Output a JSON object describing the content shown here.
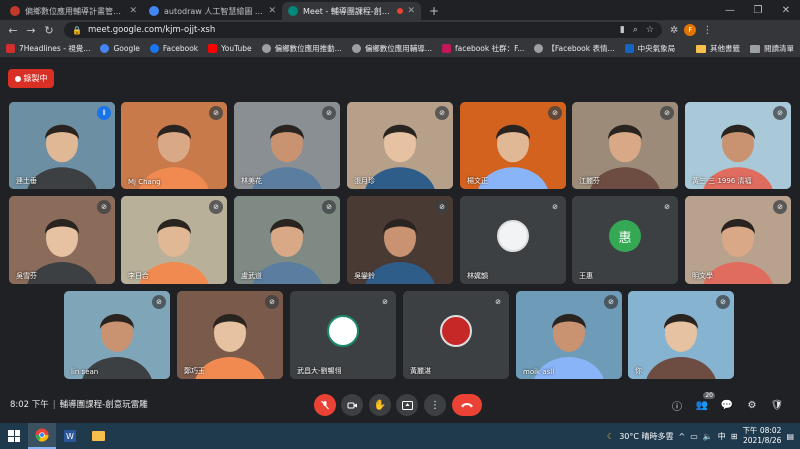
{
  "browser": {
    "tabs": [
      {
        "title": "偏鄉數位應用輔導計畫管理後台",
        "color": "#c0392b"
      },
      {
        "title": "autodraw 人工智慧繪圖 - Google",
        "color": "#4285f4"
      },
      {
        "title": "Meet - 輔導團課程-創意玩雷雕",
        "color": "#00897b",
        "active": true
      }
    ],
    "new_tab": "+",
    "window_controls": [
      "—",
      "❐",
      "✕"
    ],
    "url": "meet.google.com/kjm-ojjt-xsh",
    "profile_initial": "F"
  },
  "bookmarks": [
    {
      "label": "7Headlines - 視覺...",
      "color": "#d32f2f",
      "glyph": "7"
    },
    {
      "label": "Google",
      "color": "#4285f4",
      "glyph": "G"
    },
    {
      "label": "Facebook",
      "color": "#1877f2",
      "glyph": "f"
    },
    {
      "label": "YouTube",
      "color": "#ff0000",
      "glyph": "▶"
    },
    {
      "label": "偏鄉數位應用推動...",
      "color": "#9aa0a6",
      "glyph": "◎"
    },
    {
      "label": "偏鄉數位應用輔導...",
      "color": "#9aa0a6",
      "glyph": "◎"
    },
    {
      "label": "facebook 社群：F...",
      "color": "#c2185b",
      "glyph": "f"
    },
    {
      "label": "【Facebook 表情...",
      "color": "#9aa0a6",
      "glyph": "◎"
    },
    {
      "label": "中央氣象局",
      "color": "#1565c0",
      "glyph": "☁"
    }
  ],
  "bookmarks_right": [
    "其他書籤",
    "閱讀清單"
  ],
  "meet": {
    "recording_label": "錄製中",
    "meeting_time": "8:02 下午",
    "meeting_title": "輔導團課程-創意玩雷雕",
    "participant_count": "20",
    "participants": [
      {
        "name": "連土垂",
        "speaking": true,
        "initial": "",
        "bg": "#6d8fa3"
      },
      {
        "name": "Mj Chang",
        "speaking": false,
        "initial": "",
        "bg": "#c87a4a"
      },
      {
        "name": "林美花",
        "speaking": false,
        "initial": "",
        "bg": "#8a8f94"
      },
      {
        "name": "張月珍",
        "speaking": false,
        "initial": "",
        "bg": "#b7a08a"
      },
      {
        "name": "楊文正",
        "speaking": false,
        "initial": "",
        "bg": "#d4621f"
      },
      {
        "name": "江麗芬",
        "speaking": false,
        "initial": "",
        "bg": "#9c8b78"
      },
      {
        "name": "黃三 三 1996 清福",
        "speaking": false,
        "initial": "",
        "bg": "#a9c9d8"
      },
      {
        "name": "吳雪芬",
        "speaking": false,
        "initial": "",
        "bg": "#8b6b5a"
      },
      {
        "name": "李日合",
        "speaking": false,
        "initial": "",
        "bg": "#b9b09a"
      },
      {
        "name": "盧武道",
        "speaking": false,
        "initial": "",
        "bg": "#7f8a84"
      },
      {
        "name": "吳鑾鈴",
        "speaking": false,
        "initial": "",
        "bg": "#4a3a34"
      },
      {
        "name": "林娓韻",
        "speaking": false,
        "initial": "",
        "bg": "#3c4043"
      },
      {
        "name": "王惠",
        "speaking": false,
        "initial": "惠",
        "bg": "#3c4043"
      },
      {
        "name": "明文學",
        "speaking": false,
        "initial": "",
        "bg": "#b8a28e"
      },
      {
        "name": "lin sean",
        "speaking": false,
        "initial": "",
        "bg": "#7fa6b8"
      },
      {
        "name": "鄭巧玉",
        "speaking": false,
        "initial": "",
        "bg": "#7a5a4a"
      },
      {
        "name": "武昌大-劉暢翎",
        "speaking": false,
        "initial": "",
        "bg": "#3c4043"
      },
      {
        "name": "黃麗湛",
        "speaking": false,
        "initial": "",
        "bg": "#3c4043"
      },
      {
        "name": "moik asll",
        "speaking": false,
        "initial": "",
        "bg": "#6d9bb8"
      },
      {
        "name": "你",
        "speaking": false,
        "initial": "",
        "bg": "#86b3cf"
      }
    ]
  },
  "taskbar": {
    "weather": "30°C 晴時多雲",
    "ime": "中",
    "time": "下午 08:02",
    "date": "2021/8/26"
  }
}
